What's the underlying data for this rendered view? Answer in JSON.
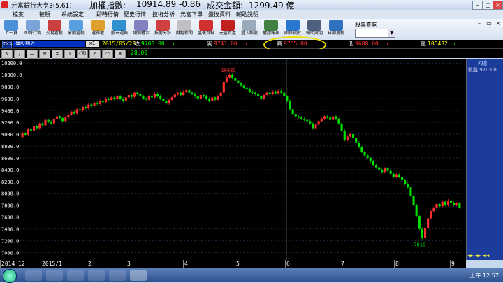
{
  "window": {
    "title": "元富銀行大亨3(5.61)",
    "index_label": "加權指數:",
    "index_value": "10914.89",
    "index_change": "-0.86",
    "amount_label": "成交金額:",
    "amount_value": "1299.49 億"
  },
  "menu": [
    "檔案",
    "被視",
    "系統設定",
    "即時行情",
    "歷史行情",
    "技術分析",
    "元富下單",
    "盤後資料",
    "輔助說明"
  ],
  "toolbar": [
    {
      "label": "上一頁",
      "color": "#4a8fd8"
    },
    {
      "label": "即時行情",
      "color": "#7aa4d8"
    },
    {
      "label": "交易看板",
      "color": "#c84040"
    },
    {
      "label": "掌融看板",
      "color": "#58a0e0"
    },
    {
      "label": "選擇權",
      "color": "#e0a030"
    },
    {
      "label": "股市週報",
      "color": "#3090d0"
    },
    {
      "label": "類價權示",
      "color": "#8080c0"
    },
    {
      "label": "技術分析",
      "color": "#d04040"
    },
    {
      "label": "財經新聞",
      "color": "#c0c0c0"
    },
    {
      "label": "盤後資料",
      "color": "#d03030"
    },
    {
      "label": "元富資產",
      "color": "#c02020"
    },
    {
      "label": "登入帳號",
      "color": "#9ab"
    },
    {
      "label": "權證報表",
      "color": "#408040"
    },
    {
      "label": "國際指數",
      "color": "#2878d0"
    },
    {
      "label": "輔助說明",
      "color": "#506080"
    },
    {
      "label": "自動更新",
      "color": "#3070c0"
    }
  ],
  "stock_query": {
    "label": "股票查詢",
    "value": ""
  },
  "quote_bar": {
    "code": "TXA",
    "name": "臺股期近",
    "multiplier": "x1",
    "date": "2015/05/29",
    "close_label": "收",
    "close": "9703.00",
    "open_label": "開",
    "open": "9741.00",
    "high_label": "高",
    "high": "9765.00",
    "low_label": "低",
    "low": "9688.00",
    "vol_label": "量",
    "volume": "105432",
    "period_value": "28.00"
  },
  "side_panel": {
    "label": "K線",
    "sub_label": "收盤",
    "sub_value": "9703.0"
  },
  "taskbar": {
    "time": "上午 12:57"
  },
  "colors": {
    "up": "#ff3030",
    "down": "#00e000",
    "axis": "#ffffff"
  },
  "chart_data": {
    "type": "candlestick",
    "ylim": [
      6900,
      10250
    ],
    "yticks": [
      7000,
      7200,
      7400,
      7600,
      7800,
      8000,
      8200,
      8400,
      8600,
      8800,
      9000,
      9200,
      9400,
      9600,
      9800,
      10000,
      10200
    ],
    "xlabels": [
      "2014",
      "12",
      "2015/1",
      "2",
      "3",
      "4",
      "5",
      "6",
      "7",
      "8",
      "9"
    ],
    "annotations": [
      {
        "text": "10033"
      },
      {
        "text": "7010"
      }
    ],
    "points": [
      [
        8950,
        9020
      ],
      [
        9010,
        8990
      ],
      [
        8990,
        9080
      ],
      [
        9080,
        9060
      ],
      [
        9060,
        9130
      ],
      [
        9130,
        9100
      ],
      [
        9100,
        9180
      ],
      [
        9180,
        9150
      ],
      [
        9150,
        9240
      ],
      [
        9240,
        9210
      ],
      [
        9210,
        9180
      ],
      [
        9180,
        9260
      ],
      [
        9260,
        9300
      ],
      [
        9300,
        9270
      ],
      [
        9270,
        9220
      ],
      [
        9220,
        9280
      ],
      [
        9280,
        9330
      ],
      [
        9330,
        9380
      ],
      [
        9380,
        9350
      ],
      [
        9350,
        9420
      ],
      [
        9420,
        9400
      ],
      [
        9400,
        9460
      ],
      [
        9460,
        9440
      ],
      [
        9440,
        9500
      ],
      [
        9500,
        9480
      ],
      [
        9480,
        9530
      ],
      [
        9530,
        9510
      ],
      [
        9510,
        9560
      ],
      [
        9560,
        9540
      ],
      [
        9540,
        9600
      ],
      [
        9600,
        9580
      ],
      [
        9580,
        9620
      ],
      [
        9620,
        9590
      ],
      [
        9590,
        9640
      ],
      [
        9640,
        9600
      ],
      [
        9600,
        9560
      ],
      [
        9560,
        9620
      ],
      [
        9620,
        9660
      ],
      [
        9660,
        9630
      ],
      [
        9630,
        9700
      ],
      [
        9700,
        9680
      ],
      [
        9680,
        9650
      ],
      [
        9650,
        9600
      ],
      [
        9600,
        9580
      ],
      [
        9580,
        9640
      ],
      [
        9640,
        9620
      ],
      [
        9620,
        9680
      ],
      [
        9680,
        9640
      ],
      [
        9640,
        9600
      ],
      [
        9600,
        9560
      ],
      [
        9560,
        9520
      ],
      [
        9520,
        9580
      ],
      [
        9580,
        9620
      ],
      [
        9620,
        9670
      ],
      [
        9670,
        9700
      ],
      [
        9700,
        9660
      ],
      [
        9660,
        9720
      ],
      [
        9720,
        9740
      ],
      [
        9740,
        9700
      ],
      [
        9700,
        9680
      ],
      [
        9680,
        9640
      ],
      [
        9640,
        9600
      ],
      [
        9600,
        9660
      ],
      [
        9660,
        9640
      ],
      [
        9640,
        9600
      ],
      [
        9600,
        9560
      ],
      [
        9560,
        9620
      ],
      [
        9620,
        9580
      ],
      [
        9580,
        9640
      ],
      [
        9640,
        9700
      ],
      [
        9700,
        9880
      ],
      [
        9880,
        9960
      ],
      [
        9960,
        10000
      ],
      [
        10000,
        9950
      ],
      [
        9950,
        9900
      ],
      [
        9900,
        9860
      ],
      [
        9860,
        9820
      ],
      [
        9820,
        9780
      ],
      [
        9780,
        9760
      ],
      [
        9760,
        9720
      ],
      [
        9720,
        9700
      ],
      [
        9700,
        9680
      ],
      [
        9680,
        9640
      ],
      [
        9640,
        9600
      ],
      [
        9600,
        9660
      ],
      [
        9660,
        9700
      ],
      [
        9700,
        9680
      ],
      [
        9680,
        9720
      ],
      [
        9720,
        9690
      ],
      [
        9690,
        9730
      ],
      [
        9730,
        9700
      ],
      [
        9700,
        9640
      ],
      [
        9640,
        9560
      ],
      [
        9560,
        9420
      ],
      [
        9420,
        9340
      ],
      [
        9340,
        9300
      ],
      [
        9300,
        9280
      ],
      [
        9280,
        9260
      ],
      [
        9260,
        9240
      ],
      [
        9240,
        9220
      ],
      [
        9220,
        9180
      ],
      [
        9180,
        9100
      ],
      [
        9100,
        9160
      ],
      [
        9160,
        9220
      ],
      [
        9220,
        9260
      ],
      [
        9260,
        9300
      ],
      [
        9300,
        9280
      ],
      [
        9280,
        9240
      ],
      [
        9240,
        9300
      ],
      [
        9300,
        9260
      ],
      [
        9260,
        9180
      ],
      [
        9180,
        9060
      ],
      [
        9060,
        8900
      ],
      [
        8900,
        8960
      ],
      [
        8960,
        9000
      ],
      [
        9000,
        8940
      ],
      [
        8940,
        8860
      ],
      [
        8860,
        8780
      ],
      [
        8780,
        8700
      ],
      [
        8700,
        8640
      ],
      [
        8640,
        8600
      ],
      [
        8600,
        8540
      ],
      [
        8540,
        8480
      ],
      [
        8480,
        8440
      ],
      [
        8440,
        8400
      ],
      [
        8400,
        8360
      ],
      [
        8360,
        8420
      ],
      [
        8420,
        8380
      ],
      [
        8380,
        8330
      ],
      [
        8330,
        8280
      ],
      [
        8280,
        8320
      ],
      [
        8320,
        8280
      ],
      [
        8280,
        8220
      ],
      [
        8220,
        8160
      ],
      [
        8160,
        8100
      ],
      [
        8100,
        7960
      ],
      [
        7960,
        7800
      ],
      [
        7800,
        7620
      ],
      [
        7620,
        7400
      ],
      [
        7400,
        7250
      ],
      [
        7250,
        7420
      ],
      [
        7420,
        7580
      ],
      [
        7580,
        7700
      ],
      [
        7700,
        7760
      ],
      [
        7760,
        7820
      ],
      [
        7820,
        7780
      ],
      [
        7780,
        7860
      ],
      [
        7860,
        7800
      ],
      [
        7800,
        7880
      ],
      [
        7880,
        7840
      ],
      [
        7840,
        7800
      ],
      [
        7800,
        7830
      ],
      [
        7830,
        7760
      ]
    ]
  }
}
